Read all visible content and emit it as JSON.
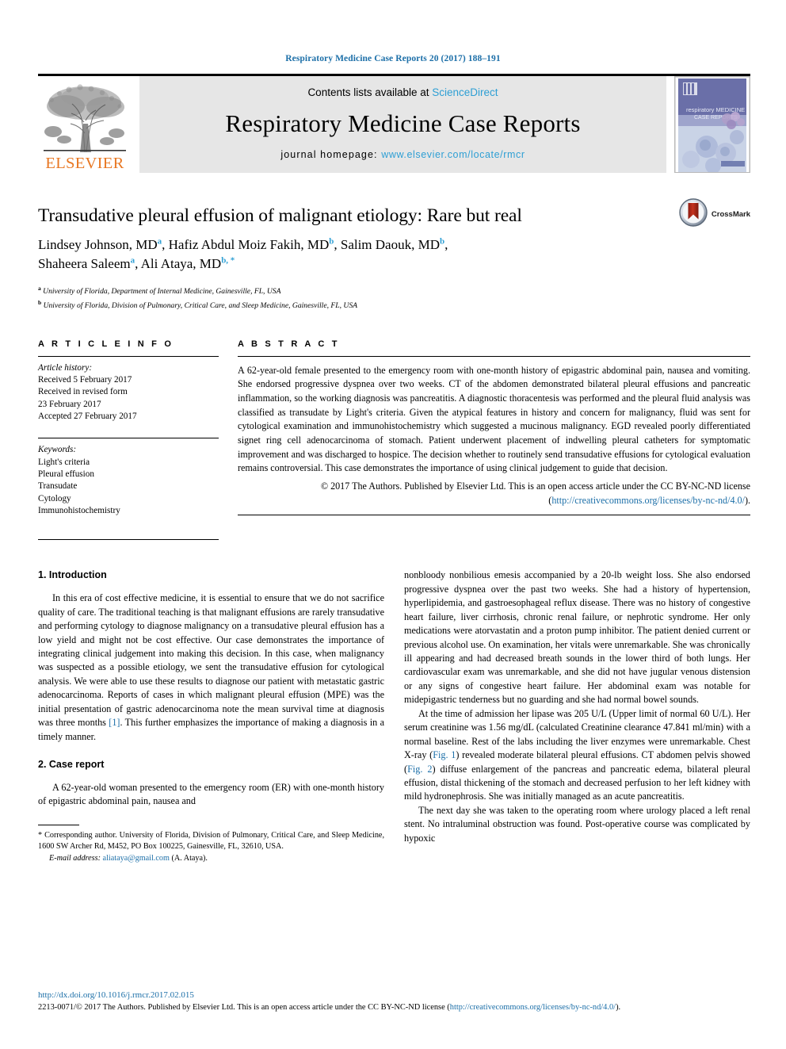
{
  "running_head": "Respiratory Medicine Case Reports 20 (2017) 188–191",
  "masthead": {
    "publisher_logo_text": "ELSEVIER",
    "contents_prefix": "Contents lists available at ",
    "contents_link": "ScienceDirect",
    "journal_name": "Respiratory Medicine Case Reports",
    "homepage_prefix": "journal homepage: ",
    "homepage_url": "www.elsevier.com/locate/rmcr",
    "cover_title_line1": "respiratory MEDICINE",
    "cover_title_line2": "CASE REPORTS"
  },
  "title": "Transudative pleural effusion of malignant etiology: Rare but real",
  "crossmark_label": "CrossMark",
  "authors_line1": "Lindsey Johnson, MD",
  "authors": [
    {
      "name": "Lindsey Johnson, MD",
      "sup": "a",
      "sep": ", "
    },
    {
      "name": "Hafiz Abdul Moiz Fakih, MD",
      "sup": "b",
      "sep": ", "
    },
    {
      "name": "Salim Daouk, MD",
      "sup": "b",
      "sep": ", "
    },
    {
      "name": "Shaheera Saleem",
      "sup": "a",
      "sep": ", "
    },
    {
      "name": "Ali Ataya, MD",
      "sup": "b, *",
      "sep": ""
    }
  ],
  "affiliations": [
    {
      "mark": "a",
      "text": "University of Florida, Department of Internal Medicine, Gainesville, FL, USA"
    },
    {
      "mark": "b",
      "text": "University of Florida, Division of Pulmonary, Critical Care, and Sleep Medicine, Gainesville, FL, USA"
    }
  ],
  "article_info": {
    "heading": "A R T I C L E   I N F O",
    "history_label": "Article history:",
    "history": [
      "Received 5 February 2017",
      "Received in revised form",
      "23 February 2017",
      "Accepted 27 February 2017"
    ],
    "keywords_label": "Keywords:",
    "keywords": [
      "Light's criteria",
      "Pleural effusion",
      "Transudate",
      "Cytology",
      "Immunohistochemistry"
    ]
  },
  "abstract": {
    "heading": "A B S T R A C T",
    "text": "A 62-year-old female presented to the emergency room with one-month history of epigastric abdominal pain, nausea and vomiting. She endorsed progressive dyspnea over two weeks. CT of the abdomen demonstrated bilateral pleural effusions and pancreatic inflammation, so the working diagnosis was pancreatitis. A diagnostic thoracentesis was performed and the pleural fluid analysis was classified as transudate by Light's criteria. Given the atypical features in history and concern for malignancy, fluid was sent for cytological examination and immunohistochemistry which suggested a mucinous malignancy. EGD revealed poorly differentiated signet ring cell adenocarcinoma of stomach. Patient underwent placement of indwelling pleural catheters for symptomatic improvement and was discharged to hospice. The decision whether to routinely send transudative effusions for cytological evaluation remains controversial. This case demonstrates the importance of using clinical judgement to guide that decision.",
    "copyright": "© 2017 The Authors. Published by Elsevier Ltd. This is an open access article under the CC BY-NC-ND license (",
    "license_url": "http://creativecommons.org/licenses/by-nc-nd/4.0/",
    "copyright_end": ")."
  },
  "body": {
    "section1_heading": "1.  Introduction",
    "section1_p1": "In this era of cost effective medicine, it is essential to ensure that we do not sacrifice quality of care. The traditional teaching is that malignant effusions are rarely transudative and performing cytology to diagnose malignancy on a transudative pleural effusion has a low yield and might not be cost effective. Our case demonstrates the importance of integrating clinical judgement into making this decision. In this case, when malignancy was suspected as a possible etiology, we sent the transudative effusion for cytological analysis. We were able to use these results to diagnose our patient with metastatic gastric adenocarcinoma. Reports of cases in which malignant pleural effusion (MPE) was the initial presentation of gastric adenocarcinoma note the mean survival time at diagnosis was three months ",
    "section1_ref": "[1]",
    "section1_p1_end": ". This further emphasizes the importance of making a diagnosis in a timely manner.",
    "section2_heading": "2.  Case report",
    "section2_p1": "A 62-year-old woman presented to the emergency room (ER) with one-month history of epigastric abdominal pain, nausea and",
    "right_p1_cont": "nonbloody nonbilious emesis accompanied by a 20-lb weight loss. She also endorsed progressive dyspnea over the past two weeks. She had a history of hypertension, hyperlipidemia, and gastroesophageal reflux disease. There was no history of congestive heart failure, liver cirrhosis, chronic renal failure, or nephrotic syndrome. Her only medications were atorvastatin and a proton pump inhibitor. The patient denied current or previous alcohol use. On examination, her vitals were unremarkable. She was chronically ill appearing and had decreased breath sounds in the lower third of both lungs. Her cardiovascular exam was unremarkable, and she did not have jugular venous distension or any signs of congestive heart failure. Her abdominal exam was notable for midepigastric tenderness but no guarding and she had normal bowel sounds.",
    "right_p2_a": "At the time of admission her lipase was 205 U/L (Upper limit of normal 60 U/L). Her serum creatinine was 1.56 mg/dL (calculated Creatinine clearance 47.841 ml/min) with a normal baseline. Rest of the labs including the liver enzymes were unremarkable. Chest X-ray (",
    "right_p2_fig1": "Fig. 1",
    "right_p2_b": ") revealed moderate bilateral pleural effusions. CT abdomen pelvis showed (",
    "right_p2_fig2": "Fig. 2",
    "right_p2_c": ") diffuse enlargement of the pancreas and pancreatic edema, bilateral pleural effusion, distal thickening of the stomach and decreased perfusion to her left kidney with mild hydronephrosis. She was initially managed as an acute pancreatitis.",
    "right_p3": "The next day she was taken to the operating room where urology placed a left renal stent. No intraluminal obstruction was found. Post-operative course was complicated by hypoxic"
  },
  "footnote": {
    "star": "*",
    "text": " Corresponding author. University of Florida, Division of Pulmonary, Critical Care, and Sleep Medicine, 1600 SW Archer Rd, M452, PO Box 100225, Gainesville, FL, 32610, USA.",
    "email_label": "E-mail address:",
    "email": "aliataya@gmail.com",
    "email_suffix": " (A. Ataya)."
  },
  "footer": {
    "doi": "http://dx.doi.org/10.1016/j.rmcr.2017.02.015",
    "legal_prefix": "2213-0071/© 2017 The Authors. Published by Elsevier Ltd. This is an open access article under the CC BY-NC-ND license (",
    "legal_link": "http://creativecommons.org/licenses/by-nc-nd/4.0/",
    "legal_suffix": ")."
  },
  "colors": {
    "link_blue": "#1c6fa8",
    "sciencedirect_blue": "#2e9fd4",
    "elsevier_orange": "#E87722",
    "band_gray": "#e6e6e6"
  }
}
